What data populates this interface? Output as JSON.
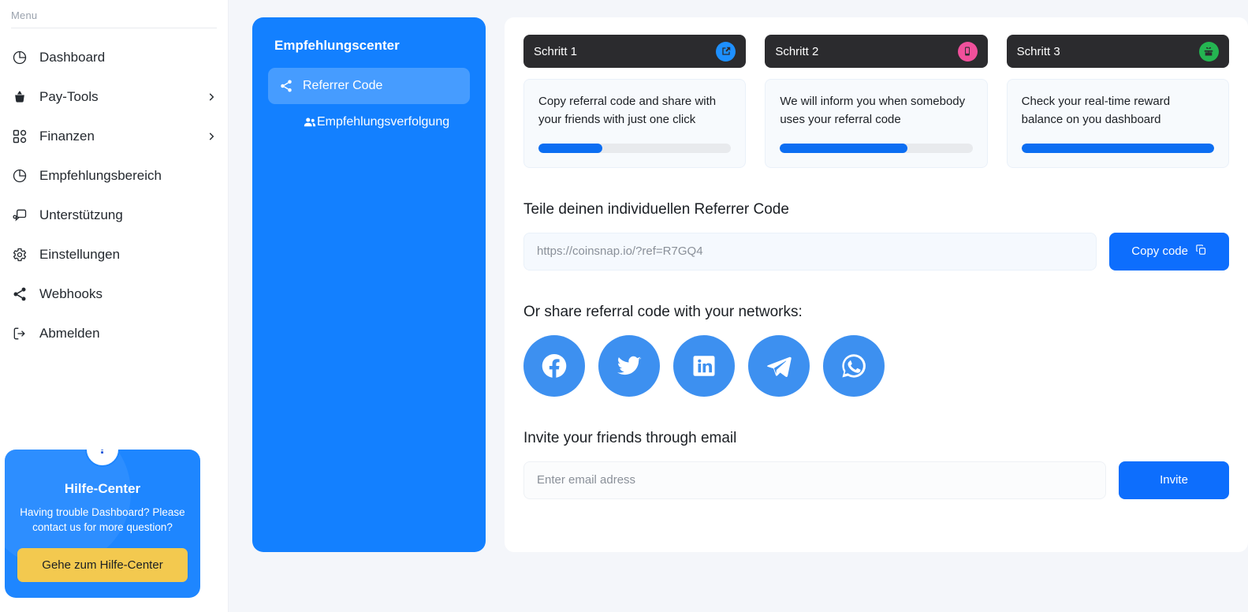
{
  "sidebar": {
    "menu_label": "Menu",
    "items": [
      {
        "label": "Dashboard",
        "icon": "pie-chart-icon",
        "chevron": false
      },
      {
        "label": "Pay-Tools",
        "icon": "basket-icon",
        "chevron": true
      },
      {
        "label": "Finanzen",
        "icon": "grid-icon",
        "chevron": true
      },
      {
        "label": "Empfehlungsbereich",
        "icon": "pie-chart-icon",
        "chevron": false
      },
      {
        "label": "Unterstützung",
        "icon": "support-chat-icon",
        "chevron": false
      },
      {
        "label": "Einstellungen",
        "icon": "gear-icon",
        "chevron": false
      },
      {
        "label": "Webhooks",
        "icon": "share-icon",
        "chevron": false
      },
      {
        "label": "Abmelden",
        "icon": "logout-icon",
        "chevron": false
      }
    ],
    "help_card": {
      "badge": "?",
      "title": "Hilfe-Center",
      "text": "Having trouble Dashboard? Please contact us for more question?",
      "button_label": "Gehe zum Hilfe-Center",
      "bg_color": "#1e86ff",
      "button_color": "#f3c94f"
    }
  },
  "referral_panel": {
    "title": "Empfehlungscenter",
    "bg_color": "#1380ff",
    "items": [
      {
        "label": "Referrer Code",
        "icon": "share-icon",
        "active": true
      },
      {
        "label": "Empfehlungsverfolgung",
        "icon": "users-icon",
        "active": false
      }
    ]
  },
  "steps": [
    {
      "title": "Schritt 1",
      "badge_icon": "share-export-icon",
      "badge_color": "#1e90ff",
      "text": "Copy referral code and share with your friends with just one click",
      "progress": 33
    },
    {
      "title": "Schritt 2",
      "badge_icon": "mobile-phone-icon",
      "badge_color": "#f0509b",
      "text": "We will inform you when somebody uses your referral code",
      "progress": 66
    },
    {
      "title": "Schritt 3",
      "badge_icon": "gift-icon",
      "badge_color": "#24b551",
      "text": "Check your real-time reward balance on you dashboard",
      "progress": 100
    }
  ],
  "referral_code": {
    "heading": "Teile deinen individuellen Referrer Code",
    "value": "https://coinsnap.io/?ref=R7GQ4",
    "copy_button": "Copy code",
    "copy_icon": "copy-icon"
  },
  "social_share": {
    "heading": "Or share referral code with your networks:",
    "networks": [
      {
        "name": "facebook-icon"
      },
      {
        "name": "twitter-icon"
      },
      {
        "name": "linkedin-icon"
      },
      {
        "name": "telegram-icon"
      },
      {
        "name": "whatsapp-icon"
      }
    ]
  },
  "email_invite": {
    "heading": "Invite your friends through email",
    "placeholder": "Enter email adress",
    "button_label": "Invite"
  }
}
